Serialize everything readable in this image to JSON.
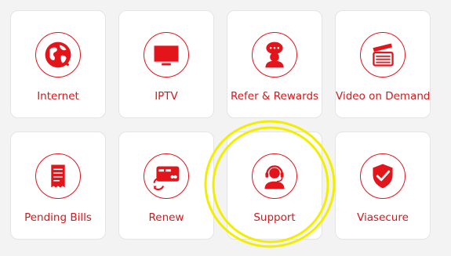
{
  "tiles": [
    {
      "label": "Internet",
      "icon": "globe-icon"
    },
    {
      "label": "IPTV",
      "icon": "tv-icon"
    },
    {
      "label": "Refer & Rewards",
      "icon": "user-chat-icon"
    },
    {
      "label": "Video on Demand",
      "icon": "clapperboard-icon"
    },
    {
      "label": "Pending Bills",
      "icon": "receipt-icon"
    },
    {
      "label": "Renew",
      "icon": "renew-card-icon"
    },
    {
      "label": "Support",
      "icon": "headset-agent-icon"
    },
    {
      "label": "Viasecure",
      "icon": "shield-check-icon"
    }
  ],
  "colors": {
    "accent": "#e4141b",
    "text": "#d3191c",
    "highlight": "#f2ee00",
    "background": "#f3f3f3"
  }
}
